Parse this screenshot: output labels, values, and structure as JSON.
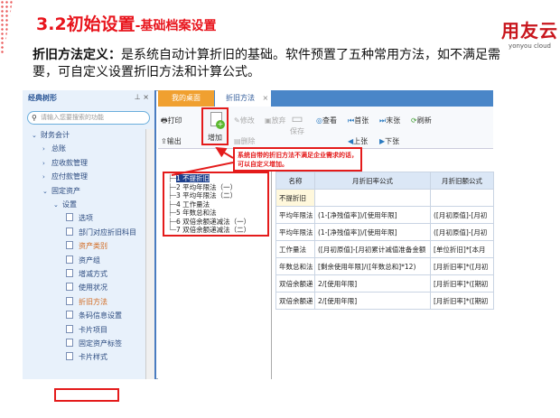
{
  "header": {
    "title": "3.2初始设置",
    "subtitle": "-基础档案设置",
    "logo_main": "用友云",
    "logo_sub": "yonyou cloud"
  },
  "description": {
    "term": "折旧方法定义：",
    "text": "是系统自动计算折旧的基础。软件预置了五种常用方法，如不满足需要，可自定义设置折旧方法和计算公式。"
  },
  "sidebar": {
    "title": "经典树形",
    "pin": "📌",
    "close": "×",
    "search_placeholder": "请输入您要搜索的功能",
    "items": [
      {
        "label": "财务会计",
        "arrow": "⌄"
      },
      {
        "label": "总账",
        "arrow": "›"
      },
      {
        "label": "应收款管理",
        "arrow": "›"
      },
      {
        "label": "应付款管理",
        "arrow": "›"
      },
      {
        "label": "固定资产",
        "arrow": "⌄"
      },
      {
        "label": "设置",
        "arrow": "⌄"
      },
      {
        "label": "选项"
      },
      {
        "label": "部门对应折旧科目"
      },
      {
        "label": "资产类别"
      },
      {
        "label": "资产组"
      },
      {
        "label": "增减方式"
      },
      {
        "label": "使用状况"
      },
      {
        "label": "折旧方法"
      },
      {
        "label": "条码信息设置"
      },
      {
        "label": "卡片项目"
      },
      {
        "label": "固定资产标签"
      },
      {
        "label": "卡片样式"
      }
    ]
  },
  "tabs": {
    "desktop": "我的桌面",
    "active": "折旧方法",
    "close": "×"
  },
  "toolbar": {
    "print": "打印",
    "export": "输出",
    "add": "增加",
    "edit": "修改",
    "discard": "放弃",
    "delete": "删除",
    "save": "保存",
    "view": "查看",
    "first": "首张",
    "last": "末张",
    "prev": "上张",
    "next": "下张",
    "refresh": "刷新"
  },
  "callout": "系统自带的折旧方法不满足企业需求的话，可以自定义增加。",
  "method_tree": [
    "1 不提折旧",
    "2 平均年限法（一）",
    "3 平均年限法（二）",
    "4 工作量法",
    "5 年数总和法",
    "6 双倍余额递减法（一）",
    "7 双倍余额递减法（二）"
  ],
  "table": {
    "headers": [
      "名称",
      "月折旧率公式",
      "月折旧额公式"
    ],
    "rows": [
      [
        "不提折旧",
        "",
        ""
      ],
      [
        "平均年限法",
        "(1-[净残值率])/[使用年限]",
        "([月初原值]-[月初"
      ],
      [
        "平均年限法",
        "(1-[净残值率])/[使用年限]",
        "([月初原值]-[月初"
      ],
      [
        "工作量法",
        "([月初原值]-[月初累计减值准备金额",
        "[单位折旧]*[本月"
      ],
      [
        "年数总和法",
        "[剩余使用年限]/([年数总和]*12)",
        "[月折旧率]*([月初"
      ],
      [
        "双倍余额递",
        "2/[使用年限]",
        "[月折旧率]*([期初"
      ],
      [
        "双倍余额递",
        "2/[使用年限]",
        "[月折旧率]*([期初"
      ]
    ]
  }
}
